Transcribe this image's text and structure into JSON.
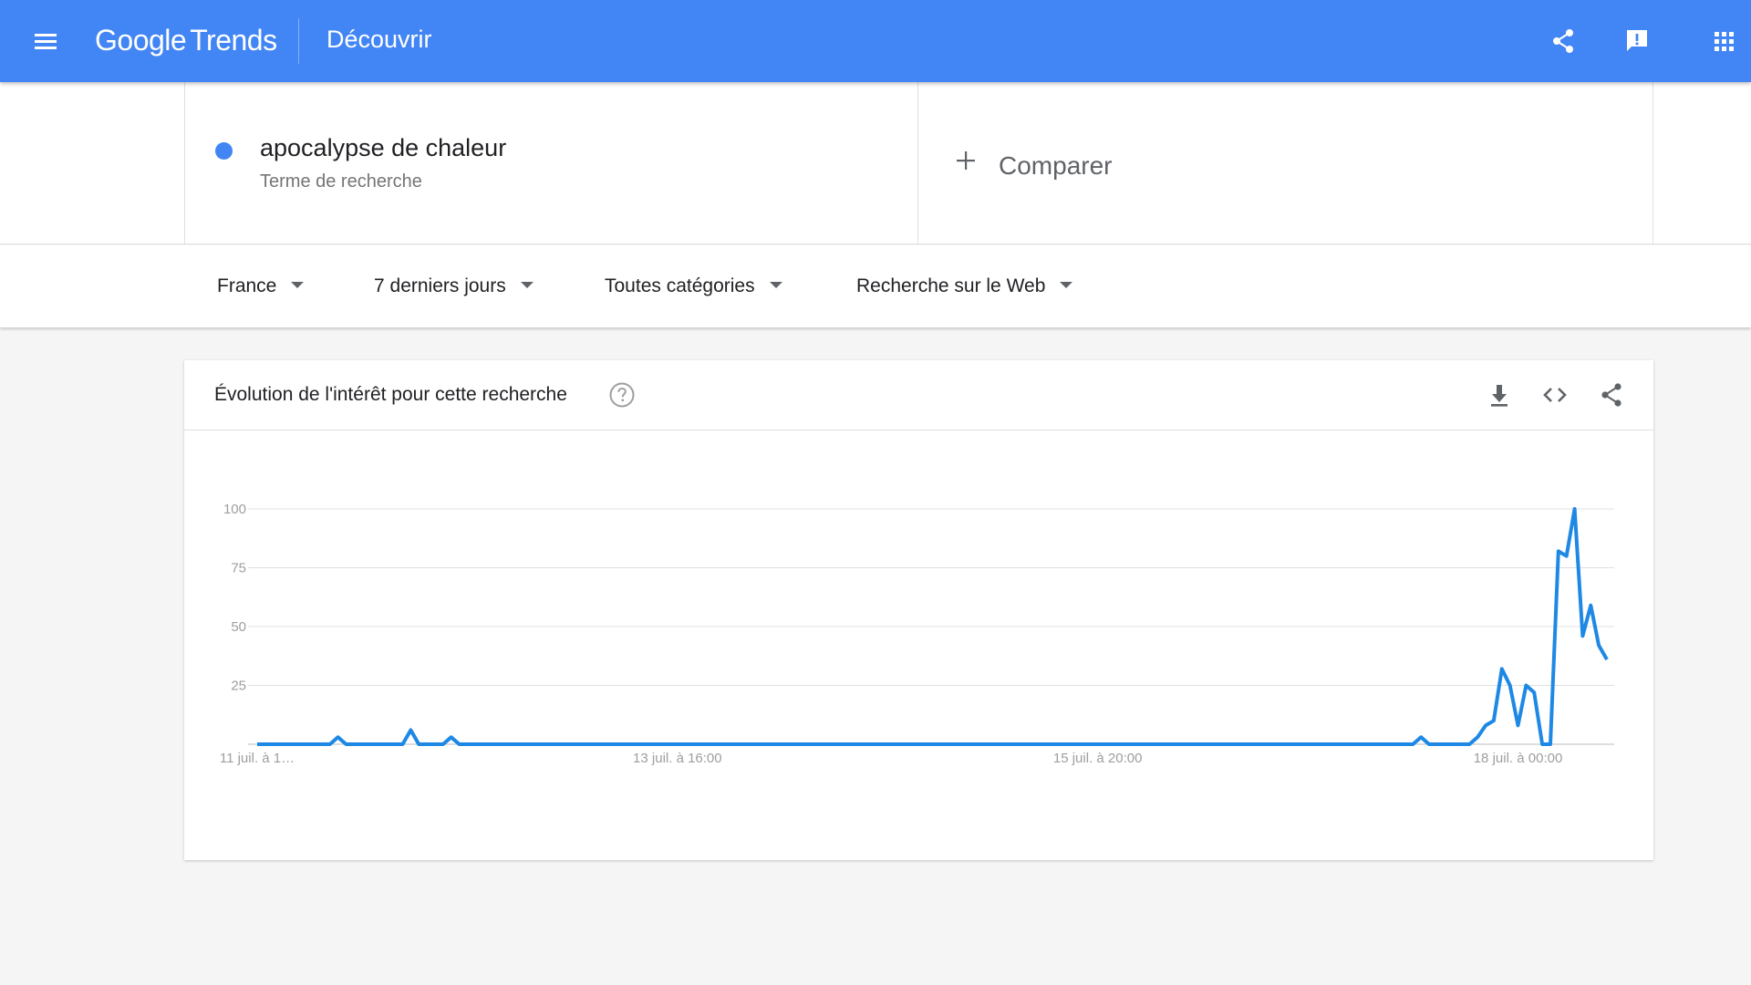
{
  "app": {
    "logo_google": "Google",
    "logo_trends": "Trends",
    "page_title": "Découvrir",
    "accent_color": "#4285f4"
  },
  "search": {
    "term": "apocalypse de chaleur",
    "term_type": "Terme de recherche",
    "term_color": "#4285f4",
    "compare_label": "Comparer"
  },
  "filters": {
    "region": "France",
    "period": "7 derniers jours",
    "category": "Toutes catégories",
    "search_type": "Recherche sur le Web"
  },
  "card": {
    "title": "Évolution de l'intérêt pour cette recherche"
  },
  "icons": {
    "menu": "menu-icon",
    "share": "share-icon",
    "feedback": "feedback-icon",
    "apps": "apps-grid-icon",
    "help": "help-icon",
    "download": "download-icon",
    "embed": "embed-code-icon",
    "card_share": "share-icon"
  },
  "chart_data": {
    "type": "line",
    "x_labels": [
      "11 juil. à 1…",
      "13 juil. à 16:00",
      "15 juil. à 20:00",
      "18 juil. à 00:00"
    ],
    "y_ticks": [
      25,
      50,
      75,
      100
    ],
    "ylim": [
      0,
      100
    ],
    "grid": true,
    "series": [
      {
        "color": "#1e88e5",
        "values": [
          0,
          0,
          0,
          0,
          0,
          0,
          0,
          0,
          0,
          0,
          3,
          0,
          0,
          0,
          0,
          0,
          0,
          0,
          0,
          6,
          0,
          0,
          0,
          0,
          3,
          0,
          0,
          0,
          0,
          0,
          0,
          0,
          0,
          0,
          0,
          0,
          0,
          0,
          0,
          0,
          0,
          0,
          0,
          0,
          0,
          0,
          0,
          0,
          0,
          0,
          0,
          0,
          0,
          0,
          0,
          0,
          0,
          0,
          0,
          0,
          0,
          0,
          0,
          0,
          0,
          0,
          0,
          0,
          0,
          0,
          0,
          0,
          0,
          0,
          0,
          0,
          0,
          0,
          0,
          0,
          0,
          0,
          0,
          0,
          0,
          0,
          0,
          0,
          0,
          0,
          0,
          0,
          0,
          0,
          0,
          0,
          0,
          0,
          0,
          0,
          0,
          0,
          0,
          0,
          0,
          0,
          0,
          0,
          0,
          0,
          0,
          0,
          0,
          0,
          0,
          0,
          0,
          0,
          0,
          0,
          0,
          0,
          0,
          0,
          0,
          0,
          0,
          0,
          0,
          0,
          0,
          0,
          0,
          0,
          0,
          0,
          0,
          0,
          0,
          0,
          0,
          0,
          0,
          0,
          3,
          0,
          0,
          0,
          0,
          0,
          0,
          3,
          8,
          10,
          32,
          25,
          8,
          25,
          22,
          0,
          0,
          82,
          80,
          100,
          46,
          59,
          42,
          36
        ]
      }
    ]
  }
}
